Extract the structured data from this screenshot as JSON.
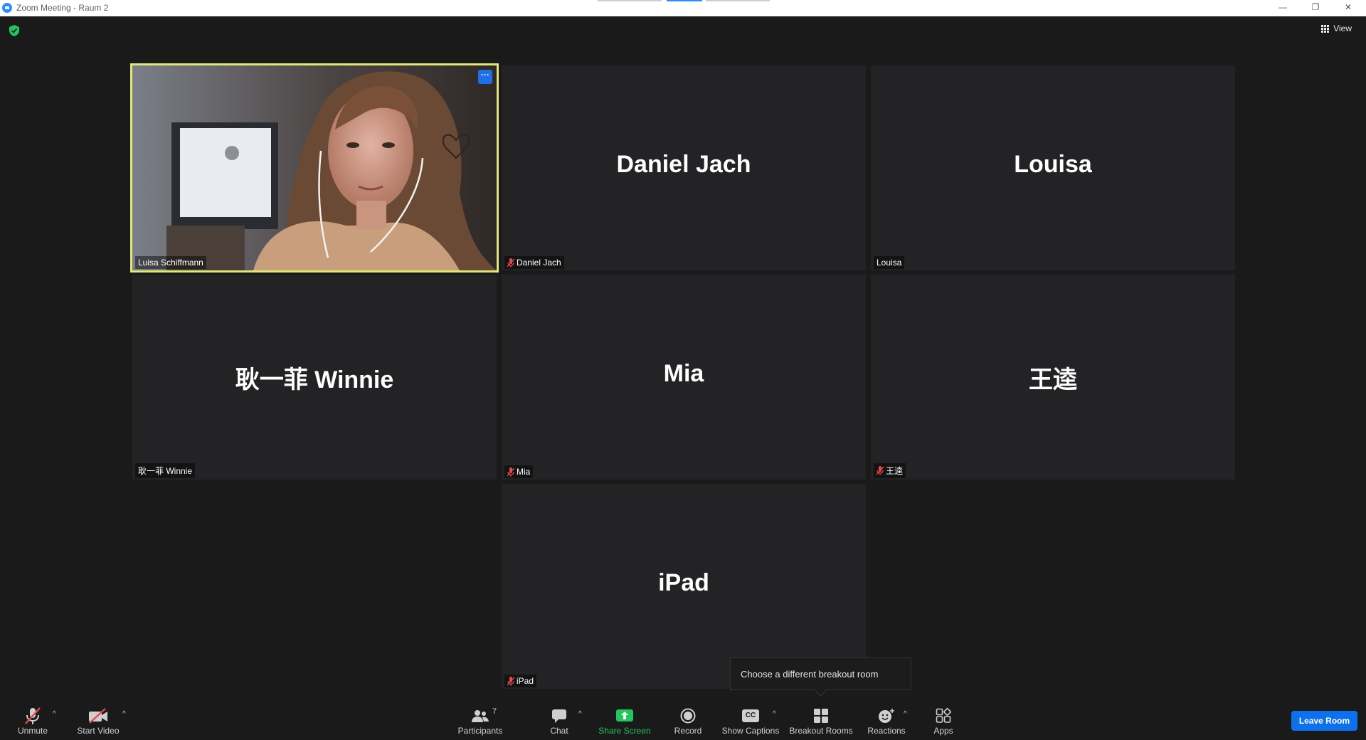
{
  "window": {
    "title": "Zoom Meeting - Raum 2",
    "minimize": "—",
    "restore": "❐",
    "close": "✕"
  },
  "topbar": {
    "view_label": "View"
  },
  "participants": [
    {
      "display": "",
      "label": "Luisa Schiffmann",
      "muted": false,
      "video": true
    },
    {
      "display": "Daniel Jach",
      "label": "Daniel Jach",
      "muted": true,
      "video": false
    },
    {
      "display": "Louisa",
      "label": "Louisa",
      "muted": false,
      "video": false
    },
    {
      "display": "耿一菲 Winnie",
      "label": "耿一菲 Winnie",
      "muted": false,
      "video": false
    },
    {
      "display": "Mia",
      "label": "Mia",
      "muted": true,
      "video": false
    },
    {
      "display": "王逵",
      "label": "王逵",
      "muted": true,
      "video": false
    },
    {
      "display": "iPad",
      "label": "iPad",
      "muted": true,
      "video": false
    }
  ],
  "tooltip": "Choose a different breakout room",
  "toolbar": {
    "unmute": "Unmute",
    "start_video": "Start Video",
    "participants": "Participants",
    "participants_count": "7",
    "chat": "Chat",
    "share_screen": "Share Screen",
    "record": "Record",
    "show_captions": "Show Captions",
    "breakout_rooms": "Breakout Rooms",
    "reactions": "Reactions",
    "apps": "Apps",
    "leave_room": "Leave Room",
    "caret": "^",
    "captions_badge": "CC"
  },
  "video_more": "···",
  "colors": {
    "background": "#1a1a1a",
    "tile": "#232325",
    "active_speaker_border": "#e0e67b",
    "accent_blue": "#0e71eb",
    "share_green": "#22c55e",
    "mute_red": "#e5484d"
  }
}
